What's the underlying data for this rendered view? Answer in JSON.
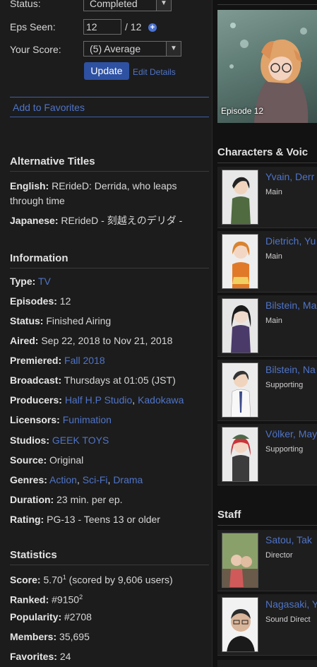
{
  "status": {
    "label": "Status:",
    "value": "Completed"
  },
  "eps": {
    "label": "Eps Seen:",
    "value": "12",
    "total": "/ 12",
    "plus_icon": "plus-circle-icon"
  },
  "score": {
    "label": "Your Score:",
    "value": "(5) Average"
  },
  "update_label": "Update",
  "edit_label": "Edit Details",
  "favorites_label": "Add to Favorites",
  "alt_titles": {
    "heading": "Alternative Titles",
    "english_label": "English:",
    "english_value": "REridеD: Derrida, who leaps through time",
    "japanese_label": "Japanese:",
    "japanese_value": "RErideD - 刻越えのデリダ -"
  },
  "information": {
    "heading": "Information",
    "type_label": "Type:",
    "type_value": "TV",
    "episodes_label": "Episodes:",
    "episodes_value": "12",
    "status_label": "Status:",
    "status_value": "Finished Airing",
    "aired_label": "Aired:",
    "aired_value": "Sep 22, 2018 to Nov 21, 2018",
    "premiered_label": "Premiered:",
    "premiered_value": "Fall 2018",
    "broadcast_label": "Broadcast:",
    "broadcast_value": "Thursdays at 01:05 (JST)",
    "producers_label": "Producers:",
    "producer1": "Half H.P Studio",
    "comma": ",",
    "producer2": "Kadokawa",
    "licensors_label": "Licensors:",
    "licensors_value": "Funimation",
    "studios_label": "Studios:",
    "studios_value": "GEEK TOYS",
    "source_label": "Source:",
    "source_value": "Original",
    "genres_label": "Genres:",
    "genre1": "Action",
    "genre2": "Sci-Fi",
    "genre3": "Drama",
    "duration_label": "Duration:",
    "duration_value": "23 min. per ep.",
    "rating_label": "Rating:",
    "rating_value": "PG-13 - Teens 13 or older"
  },
  "statistics": {
    "heading": "Statistics",
    "score_label": "Score:",
    "score_value": "5.70",
    "score_sup": "1",
    "score_users": "(scored by 9,606 users)",
    "ranked_label": "Ranked:",
    "ranked_value": "#9150",
    "ranked_sup": "2",
    "popularity_label": "Popularity:",
    "popularity_value": "#2708",
    "members_label": "Members:",
    "members_value": "35,695",
    "favorites_label": "Favorites:",
    "favorites_value": "24"
  },
  "episode_caption": "Episode 12",
  "characters": {
    "heading": "Characters & Voic",
    "items": [
      {
        "name": "Yvain, Derr",
        "role": "Main"
      },
      {
        "name": "Dietrich, Yu",
        "role": "Main"
      },
      {
        "name": "Bilstein, Ma",
        "role": "Main"
      },
      {
        "name": "Bilstein, Na",
        "role": "Supporting"
      },
      {
        "name": "Völker, May",
        "role": "Supporting"
      }
    ]
  },
  "staff": {
    "heading": "Staff",
    "items": [
      {
        "name": "Satou, Tak",
        "role": "Director"
      },
      {
        "name": "Nagasaki, Y",
        "role": "Sound Direct"
      }
    ]
  },
  "colors": {
    "link": "#4f74c8",
    "button": "#2e51a2",
    "panel": "#1c1c1c"
  }
}
